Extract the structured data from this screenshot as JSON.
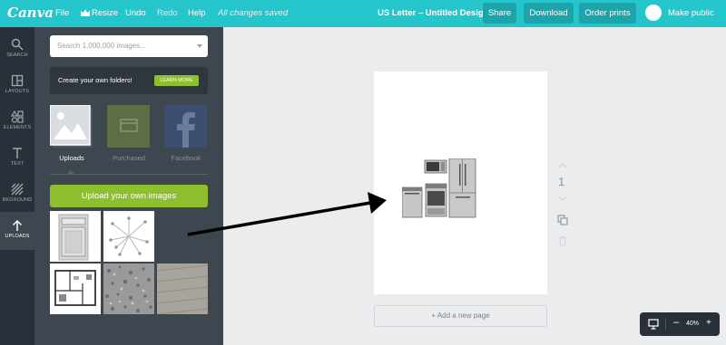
{
  "topbar": {
    "logo": "Canva",
    "menu": {
      "file": "File",
      "resize": "Resize",
      "undo": "Undo",
      "redo": "Redo",
      "help": "Help"
    },
    "status": "All changes saved",
    "doc_title": "US Letter – Untitled Design",
    "share": "Share",
    "download": "Download",
    "order_prints": "Order prints",
    "make_public": "Make public"
  },
  "rail": [
    {
      "label": "SEARCH",
      "icon": "search-icon"
    },
    {
      "label": "LAYOUTS",
      "icon": "layouts-icon"
    },
    {
      "label": "ELEMENTS",
      "icon": "elements-icon"
    },
    {
      "label": "TEXT",
      "icon": "text-icon"
    },
    {
      "label": "BKGROUND",
      "icon": "background-icon"
    },
    {
      "label": "UPLOADS",
      "icon": "uploads-icon",
      "active": true
    }
  ],
  "panel": {
    "search_placeholder": "Search 1,000,000 images...",
    "promo_text": "Create your own folders!",
    "promo_button": "LEARN MORE",
    "tabs": [
      {
        "label": "Uploads",
        "active": true
      },
      {
        "label": "Purchased"
      },
      {
        "label": "Facebook"
      }
    ],
    "upload_button": "Upload your own images"
  },
  "canvas": {
    "add_page": "+ Add a new page",
    "page_number": "1"
  },
  "zoom": {
    "level": "40%"
  },
  "colors": {
    "accent": "#25c5cc",
    "green": "#8dbf2e",
    "dark": "#293039",
    "panel": "#3e4650"
  }
}
